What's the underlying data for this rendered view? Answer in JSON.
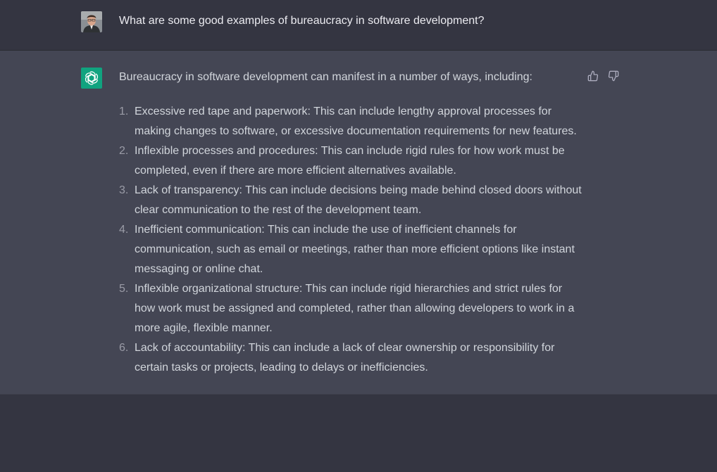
{
  "conversation": {
    "user_message": {
      "avatar": "user-photo",
      "text": "What are some good examples of bureaucracy in software development?"
    },
    "assistant_message": {
      "avatar": "openai-logo-icon",
      "intro": "Bureaucracy in software development can manifest in a number of ways, including:",
      "items": [
        {
          "num": "1.",
          "text": "Excessive red tape and paperwork: This can include lengthy approval processes for making changes to software, or excessive documentation requirements for new features."
        },
        {
          "num": "2.",
          "text": "Inflexible processes and procedures: This can include rigid rules for how work must be completed, even if there are more efficient alternatives available."
        },
        {
          "num": "3.",
          "text": "Lack of transparency: This can include decisions being made behind closed doors without clear communication to the rest of the development team."
        },
        {
          "num": "4.",
          "text": "Inefficient communication: This can include the use of inefficient channels for communication, such as email or meetings, rather than more efficient options like instant messaging or online chat."
        },
        {
          "num": "5.",
          "text": "Inflexible organizational structure: This can include rigid hierarchies and strict rules for how work must be assigned and completed, rather than allowing developers to work in a more agile, flexible manner."
        },
        {
          "num": "6.",
          "text": "Lack of accountability: This can include a lack of clear ownership or responsibility for certain tasks or projects, leading to delays or inefficiencies."
        }
      ],
      "feedback_icons": [
        "thumbs-up-icon",
        "thumbs-down-icon"
      ]
    }
  },
  "colors": {
    "page_bg": "#343541",
    "assistant_bg": "#444654",
    "bot_avatar": "#10a37f",
    "text": "#d1d5db",
    "list_number": "#9a9ba6"
  }
}
